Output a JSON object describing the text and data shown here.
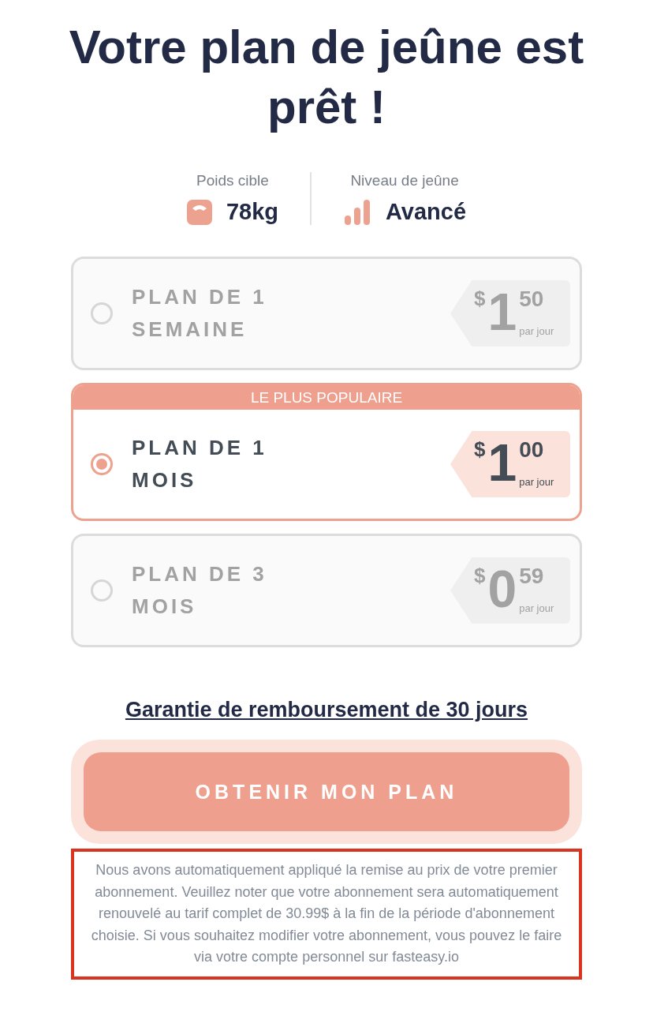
{
  "title": "Votre plan de jeûne est prêt !",
  "stats": [
    {
      "kind": "weight",
      "label": "Poids cible",
      "value": "78kg"
    },
    {
      "kind": "level",
      "label": "Niveau de jeûne",
      "value": "Avancé"
    }
  ],
  "plans": [
    {
      "name": "PLAN DE 1 SEMAINE",
      "selected": false,
      "currency": "$",
      "whole": "1",
      "cents": "50",
      "unit": "par jour"
    },
    {
      "name": "PLAN DE 1 MOIS",
      "selected": true,
      "badge": "LE PLUS POPULAIRE",
      "currency": "$",
      "whole": "1",
      "cents": "00",
      "unit": "par jour"
    },
    {
      "name": "PLAN DE 3 MOIS",
      "selected": false,
      "currency": "$",
      "whole": "0",
      "cents": "59",
      "unit": "par jour"
    }
  ],
  "guarantee": "Garantie de remboursement de 30 jours",
  "cta": "OBTENIR MON PLAN",
  "disclaimer": "Nous avons automatiquement appliqué la remise au prix de votre premier abonnement. Veuillez noter que votre abonnement sera automatiquement renouvelé au tarif complet de 30.99$ à la fin de la période d'abonnement choisie. Si vous souhaitez modifier votre abonnement, vous pouvez le faire via votre compte personnel sur fasteasy.io"
}
